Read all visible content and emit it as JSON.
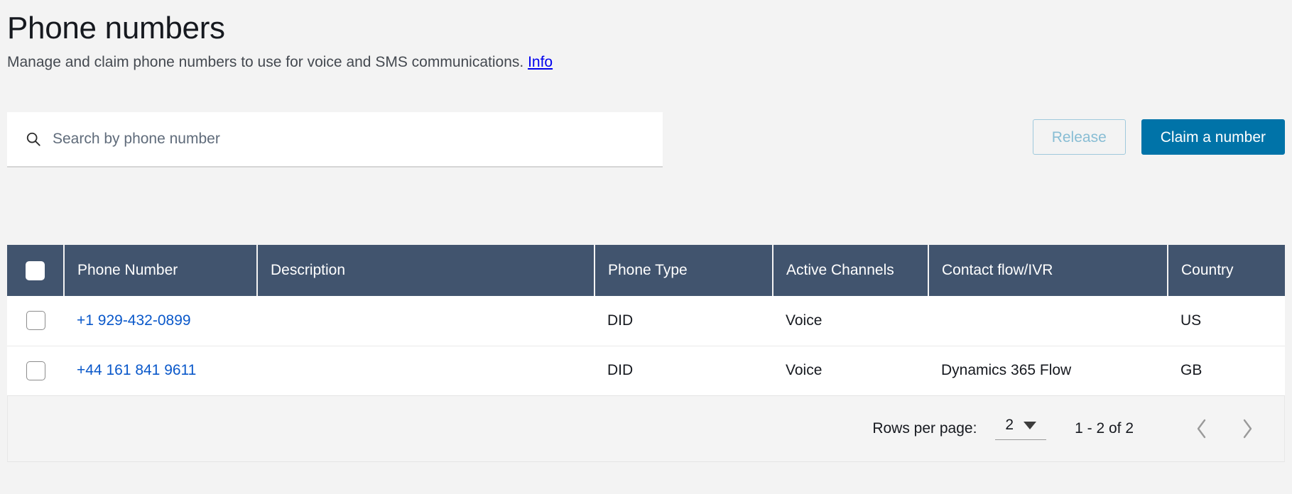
{
  "header": {
    "title": "Phone numbers",
    "subtitle": "Manage and claim phone numbers to use for voice and SMS communications.",
    "info_link": "Info"
  },
  "search": {
    "placeholder": "Search by phone number",
    "value": "",
    "icon": "search-icon"
  },
  "toolbar": {
    "release_label": "Release",
    "claim_label": "Claim a number"
  },
  "table": {
    "columns": [
      "Phone Number",
      "Description",
      "Phone Type",
      "Active Channels",
      "Contact flow/IVR",
      "Country"
    ],
    "rows": [
      {
        "phone_number": "+1 929-432-0899",
        "description": "",
        "phone_type": "DID",
        "active_channels": "Voice",
        "contact_flow": "",
        "country": "US"
      },
      {
        "phone_number": "+44 161 841 9611",
        "description": "",
        "phone_type": "DID",
        "active_channels": "Voice",
        "contact_flow": "Dynamics 365 Flow",
        "country": "GB"
      }
    ]
  },
  "pagination": {
    "rows_per_page_label": "Rows per page:",
    "rows_per_page_value": "2",
    "range_label": "1 - 2  of 2",
    "prev_icon": "chevron-left-icon",
    "next_icon": "chevron-right-icon"
  },
  "colors": {
    "page_background": "#f3f3f3",
    "table_header": "#41546e",
    "primary_button": "#0073a8",
    "link": "#0a58ca",
    "info_link": "#0000ee"
  }
}
